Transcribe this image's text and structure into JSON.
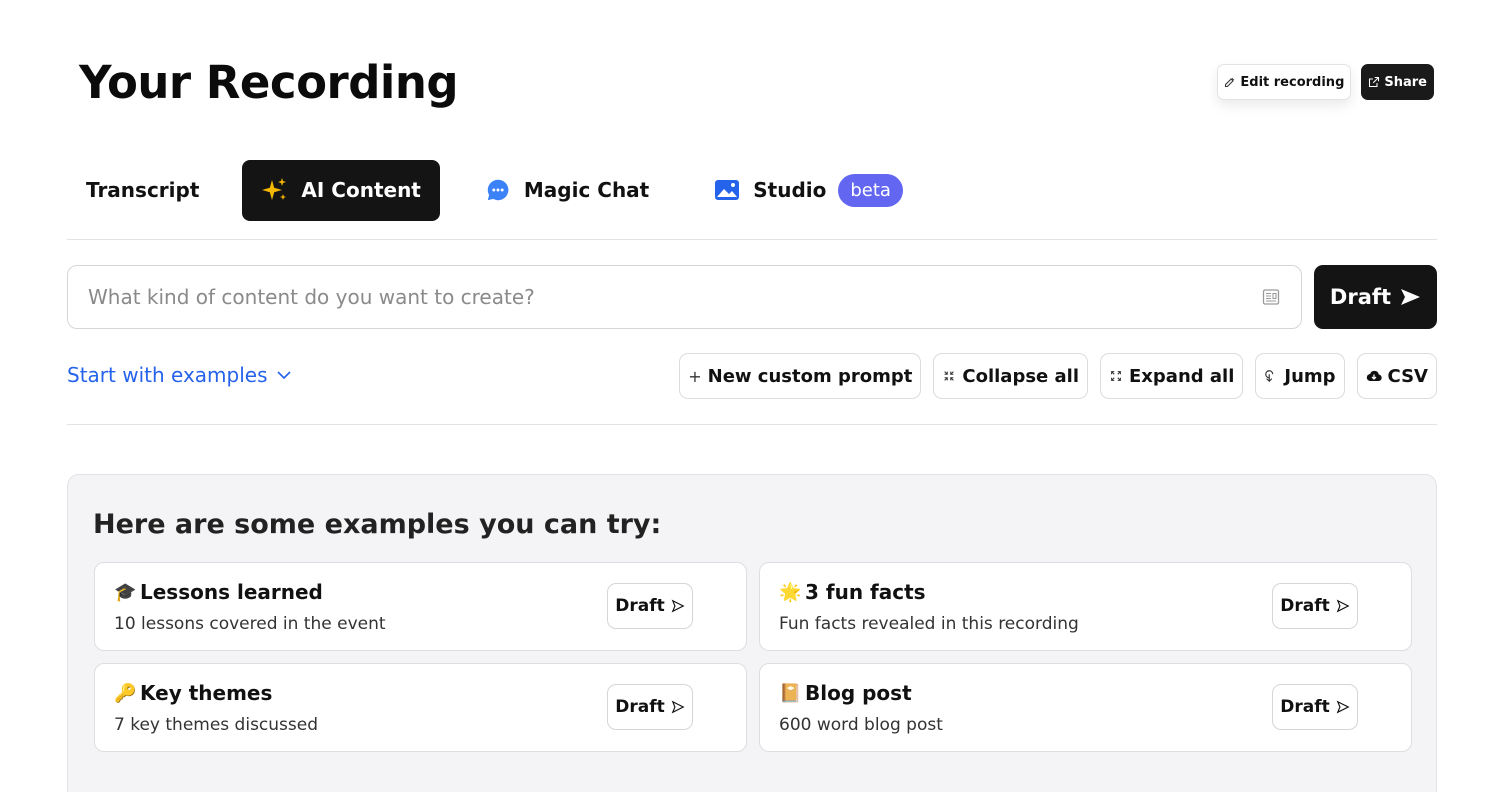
{
  "page": {
    "title": "Your Recording"
  },
  "top_actions": {
    "edit_label": "Edit recording",
    "share_label": "Share"
  },
  "tabs": [
    {
      "label": "Transcript",
      "icon": "none",
      "active": false
    },
    {
      "label": "AI Content",
      "icon": "sparkles-icon",
      "active": true
    },
    {
      "label": "Magic Chat",
      "icon": "chat-bubble-icon",
      "active": false
    },
    {
      "label": "Studio",
      "icon": "image-icon",
      "active": false,
      "badge": "beta"
    }
  ],
  "prompt": {
    "placeholder": "What kind of content do you want to create?",
    "value": "",
    "draft_label": "Draft"
  },
  "examples_toggle": {
    "label": "Start with examples"
  },
  "tools": {
    "new_prompt": "New custom prompt",
    "collapse_all": "Collapse all",
    "expand_all": "Expand all",
    "jump": "Jump",
    "csv": "CSV"
  },
  "examples": {
    "heading": "Here are some examples you can try:",
    "items": [
      {
        "emoji": "🎓",
        "title": "Lessons learned",
        "description": "10 lessons covered in the event",
        "draft_label": "Draft"
      },
      {
        "emoji": "🌟",
        "title": "3 fun facts",
        "description": "Fun facts revealed in this recording",
        "draft_label": "Draft"
      },
      {
        "emoji": "🔑",
        "title": "Key themes",
        "description": "7 key themes discussed",
        "draft_label": "Draft"
      },
      {
        "emoji": "📔",
        "title": "Blog post",
        "description": "600 word blog post",
        "draft_label": "Draft"
      }
    ]
  },
  "colors": {
    "accent_link": "#2563eb",
    "beta_badge": "#6366f1",
    "dark_button": "#141414",
    "sparkles": "#f5b800",
    "chat_icon": "#3b82f6",
    "studio_icon": "#2563eb"
  }
}
